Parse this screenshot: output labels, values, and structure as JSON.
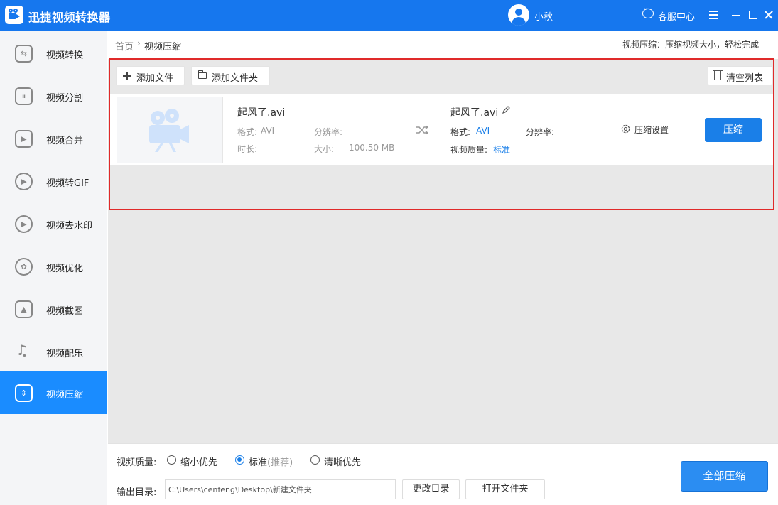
{
  "app": {
    "title": "迅捷视频转换器",
    "user_name": "小秋",
    "customer_service": "客服中心"
  },
  "sidebar": {
    "items": [
      {
        "label": "视频转换",
        "icon": "convert-icon"
      },
      {
        "label": "视频分割",
        "icon": "split-icon"
      },
      {
        "label": "视频合并",
        "icon": "merge-icon"
      },
      {
        "label": "视频转GIF",
        "icon": "gif-icon"
      },
      {
        "label": "视频去水印",
        "icon": "watermark-icon"
      },
      {
        "label": "视频优化",
        "icon": "optimize-icon"
      },
      {
        "label": "视频截图",
        "icon": "screenshot-icon"
      },
      {
        "label": "视频配乐",
        "icon": "music-icon"
      },
      {
        "label": "视频压缩",
        "icon": "compress-icon",
        "active": true
      }
    ]
  },
  "breadcrumb": {
    "home": "首页",
    "separator": "›",
    "current": "视频压缩"
  },
  "tagline": "视频压缩：压缩视频大小，轻松完成",
  "toolbar": {
    "add_file": "添加文件",
    "add_folder": "添加文件夹",
    "clear_list": "清空列表"
  },
  "file": {
    "source": {
      "name": "起风了.avi",
      "format_label": "格式:",
      "format": "AVI",
      "resolution_label": "分辨率:",
      "resolution": "",
      "duration_label": "时长:",
      "duration": "",
      "size_label": "大小:",
      "size": "100.50 MB"
    },
    "output": {
      "name": "起风了.avi",
      "format_label": "格式:",
      "format": "AVI",
      "resolution_label": "分辨率:",
      "resolution": "",
      "quality_label": "视频质量:",
      "quality": "标准"
    },
    "settings_label": "压缩设置",
    "compress_label": "压缩"
  },
  "bottom": {
    "quality_label": "视频质量:",
    "options": [
      {
        "label": "缩小优先",
        "hint": "",
        "checked": false
      },
      {
        "label": "标准",
        "hint": "(推荐)",
        "checked": true
      },
      {
        "label": "清晰优先",
        "hint": "",
        "checked": false
      }
    ],
    "output_label": "输出目录:",
    "output_path": "C:\\Users\\cenfeng\\Desktop\\新建文件夹",
    "change_dir": "更改目录",
    "open_folder": "打开文件夹",
    "compress_all": "全部压缩"
  },
  "colors": {
    "primary": "#1677ee",
    "accent": "#1a7fe8",
    "highlight_border": "#e02a2a",
    "sidebar_active": "#1a8cff"
  }
}
